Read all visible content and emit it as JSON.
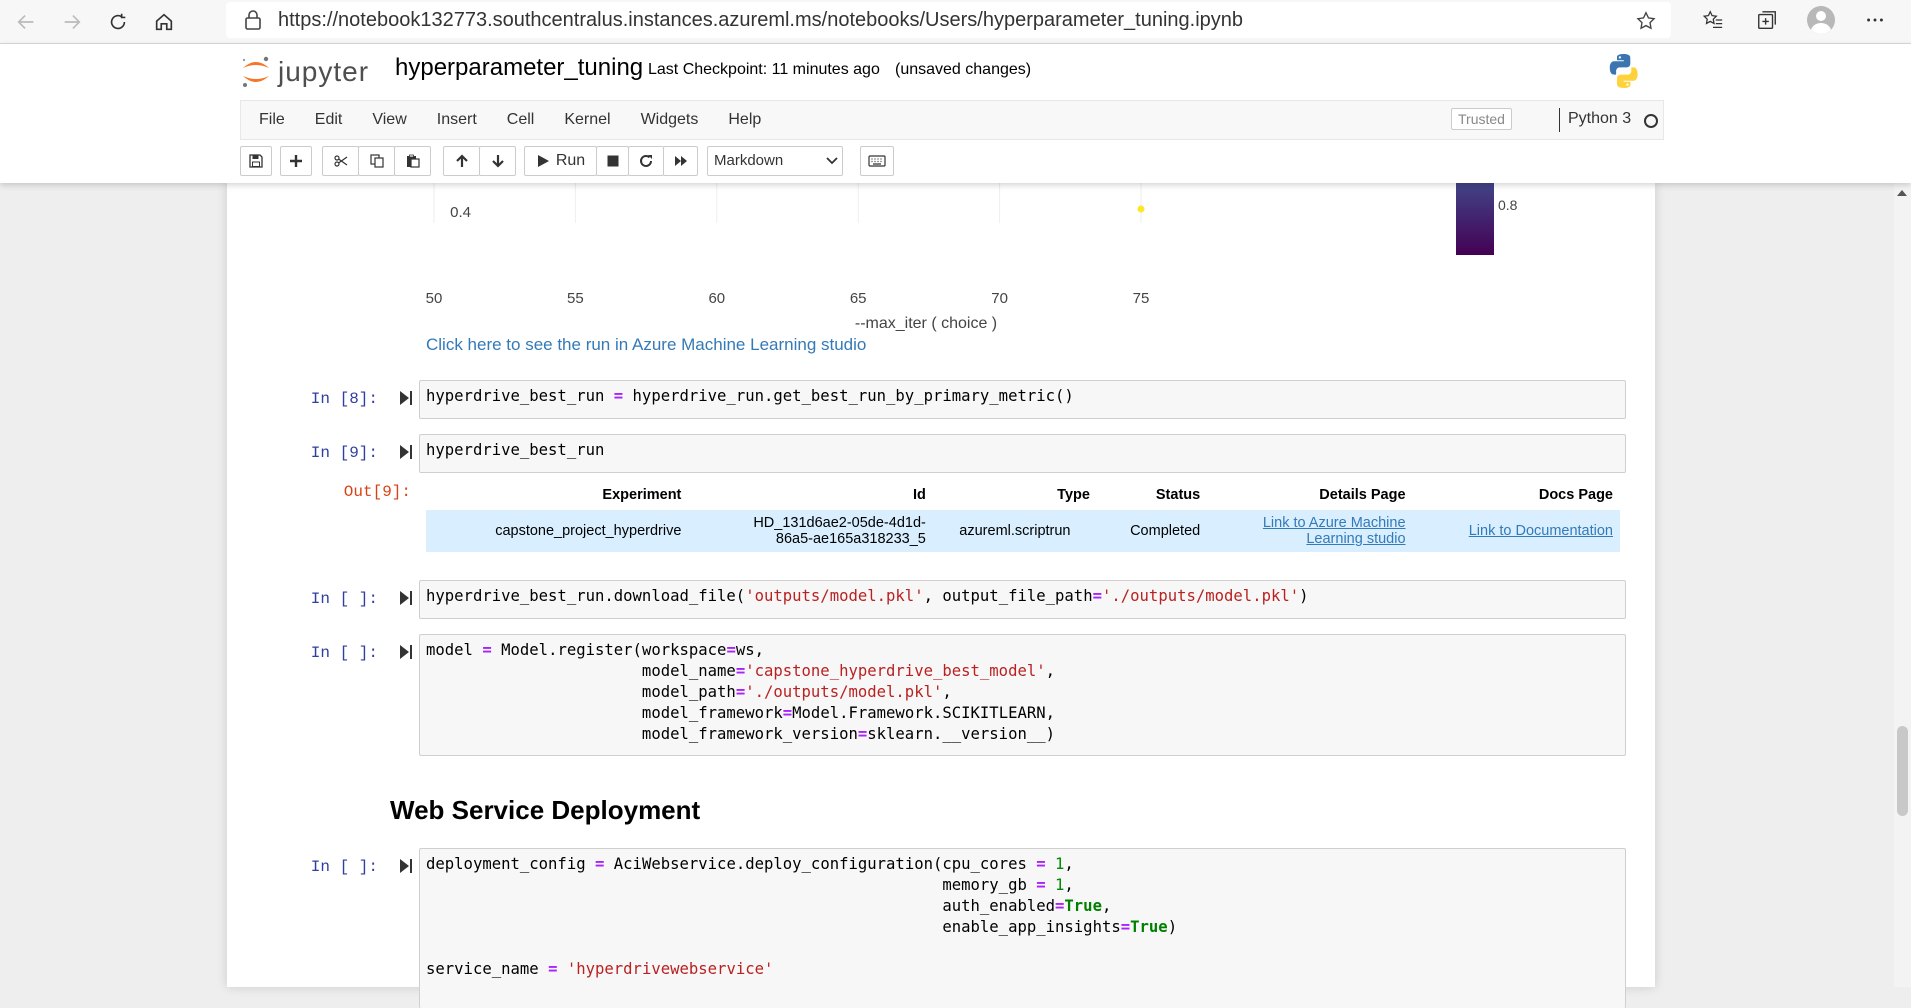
{
  "browser": {
    "url": "https://notebook132773.southcentralus.instances.azureml.ms/notebooks/Users/hyperparameter_tuning.ipynb"
  },
  "header": {
    "logo_text": "jupyter",
    "notebook_title": "hyperparameter_tuning",
    "checkpoint": "Last Checkpoint: 11 minutes ago",
    "unsaved": "(unsaved changes)"
  },
  "menu": {
    "items": [
      "File",
      "Edit",
      "View",
      "Insert",
      "Cell",
      "Kernel",
      "Widgets",
      "Help"
    ],
    "trusted": "Trusted",
    "kernel": "Python 3"
  },
  "toolbar": {
    "run_label": "Run",
    "cell_type": "Markdown"
  },
  "chart_data": {
    "type": "scatter",
    "xlabel": "--max_iter ( choice )",
    "x_ticks": [
      "50",
      "55",
      "60",
      "65",
      "70",
      "75"
    ],
    "y_ticks": [
      "0.4"
    ],
    "colorbar_tick": "0.8",
    "points": [
      {
        "x": 75,
        "y": 0.41
      }
    ]
  },
  "azure_link": "Click here to see the run in Azure Machine Learning studio",
  "cells": {
    "c8": {
      "prompt": "In [8]:"
    },
    "c9": {
      "prompt": "In [9]:",
      "out_prompt": "Out[9]:"
    },
    "c10": {
      "prompt": "In [ ]:"
    },
    "c11": {
      "prompt": "In [ ]:"
    },
    "c12": {
      "prompt": "In [ ]:"
    }
  },
  "run_table": {
    "headers": [
      "Experiment",
      "Id",
      "Type",
      "Status",
      "Details Page",
      "Docs Page"
    ],
    "row": {
      "experiment": "capstone_project_hyperdrive",
      "id_line1": "HD_131d6ae2-05de-4d1d-",
      "id_line2": "86a5-ae165a318233_5",
      "type": "azureml.scriptrun",
      "status": "Completed",
      "details_line1": "Link to Azure Machine",
      "details_line2": "Learning studio",
      "docs": "Link to Documentation"
    }
  },
  "markdown_heading": "Web Service Deployment"
}
